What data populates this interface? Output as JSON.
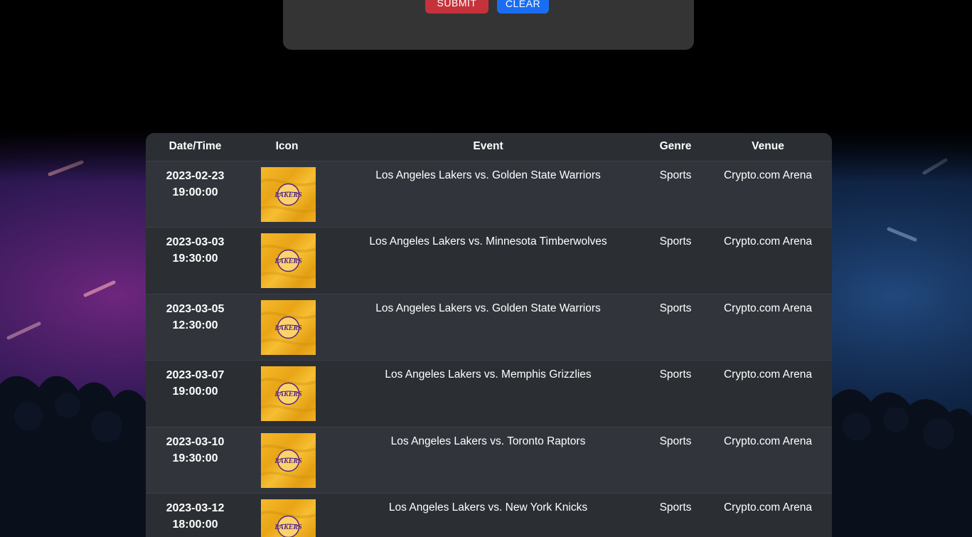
{
  "form": {
    "submit_label": "SUBMIT",
    "clear_label": "CLEAR"
  },
  "table": {
    "headers": {
      "datetime": "Date/Time",
      "icon": "Icon",
      "event": "Event",
      "genre": "Genre",
      "venue": "Venue"
    },
    "rows": [
      {
        "date": "2023-02-23",
        "time": "19:00:00",
        "icon": "lakers-logo-icon",
        "event": "Los Angeles Lakers vs. Golden State Warriors",
        "genre": "Sports",
        "venue": "Crypto.com Arena"
      },
      {
        "date": "2023-03-03",
        "time": "19:30:00",
        "icon": "lakers-logo-icon",
        "event": "Los Angeles Lakers vs. Minnesota Timberwolves",
        "genre": "Sports",
        "venue": "Crypto.com Arena"
      },
      {
        "date": "2023-03-05",
        "time": "12:30:00",
        "icon": "lakers-logo-icon",
        "event": "Los Angeles Lakers vs. Golden State Warriors",
        "genre": "Sports",
        "venue": "Crypto.com Arena"
      },
      {
        "date": "2023-03-07",
        "time": "19:00:00",
        "icon": "lakers-logo-icon",
        "event": "Los Angeles Lakers vs. Memphis Grizzlies",
        "genre": "Sports",
        "venue": "Crypto.com Arena"
      },
      {
        "date": "2023-03-10",
        "time": "19:30:00",
        "icon": "lakers-logo-icon",
        "event": "Los Angeles Lakers vs. Toronto Raptors",
        "genre": "Sports",
        "venue": "Crypto.com Arena"
      },
      {
        "date": "2023-03-12",
        "time": "18:00:00",
        "icon": "lakers-logo-icon",
        "event": "Los Angeles Lakers vs. New York Knicks",
        "genre": "Sports",
        "venue": "Crypto.com Arena"
      }
    ]
  },
  "logo_text": "LAKERS",
  "colors": {
    "submit": "#c6323c",
    "clear": "#1a6df0",
    "header_bg": "#2b2f34",
    "row_odd": "#31353b",
    "row_even": "#2b2e33",
    "lakers_gold": "#f2b01e",
    "lakers_purple": "#552583"
  }
}
